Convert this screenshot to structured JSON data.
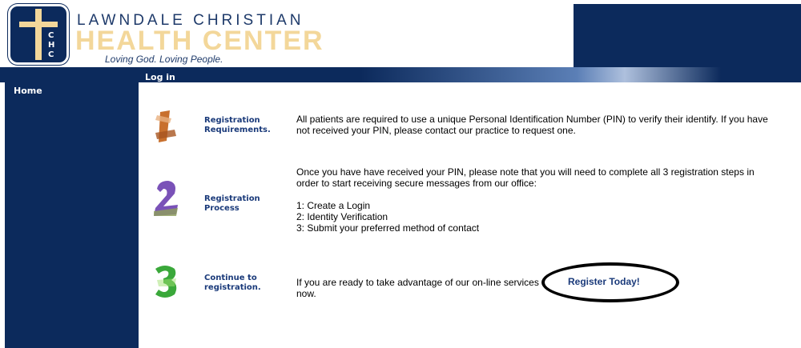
{
  "brand": {
    "line1": "LAWNDALE CHRISTIAN",
    "line2": "HEALTH CENTER",
    "tagline": "Loving God. Loving People.",
    "logo_letters": [
      "C",
      "H",
      "C"
    ]
  },
  "header": {
    "title": "Log in"
  },
  "sidebar": {
    "home_label": "Home"
  },
  "steps": [
    {
      "number": "1",
      "label": "Registration Requirements.",
      "text": "All patients are required to use a unique Personal Identification Number (PIN) to verify their identify. If you have not received your PIN, please contact our practice to request one."
    },
    {
      "number": "2",
      "label": "Registration Process",
      "text": "Once you have have received your PIN, please note that you will need to complete all 3 registration steps in order to start receiving secure messages from our office:",
      "list": [
        "1:  Create a Login",
        "2:  Identity Verification",
        "3:  Submit your preferred method of contact"
      ]
    },
    {
      "number": "3",
      "label": "Continue to registration.",
      "text": "If you are ready to take advantage of our on-line services now.",
      "link_label": "Register Today!"
    }
  ],
  "colors": {
    "navy": "#0c2a5c",
    "gold": "#f3d79a",
    "link": "#1a3a7a"
  }
}
